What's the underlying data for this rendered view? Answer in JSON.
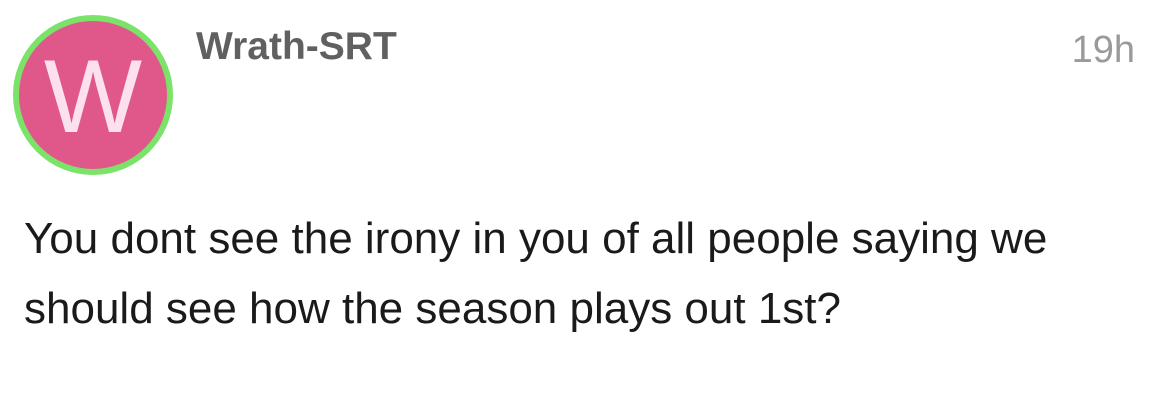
{
  "post": {
    "avatar": {
      "letter": "W",
      "background_color": "#e0578a",
      "ring_color": "#7be26a",
      "letter_color": "#fce0ee"
    },
    "username": "Wrath-SRT",
    "timestamp": "19h",
    "body": "You dont see the irony in you of all people saying we should see how the season plays out 1st?"
  }
}
